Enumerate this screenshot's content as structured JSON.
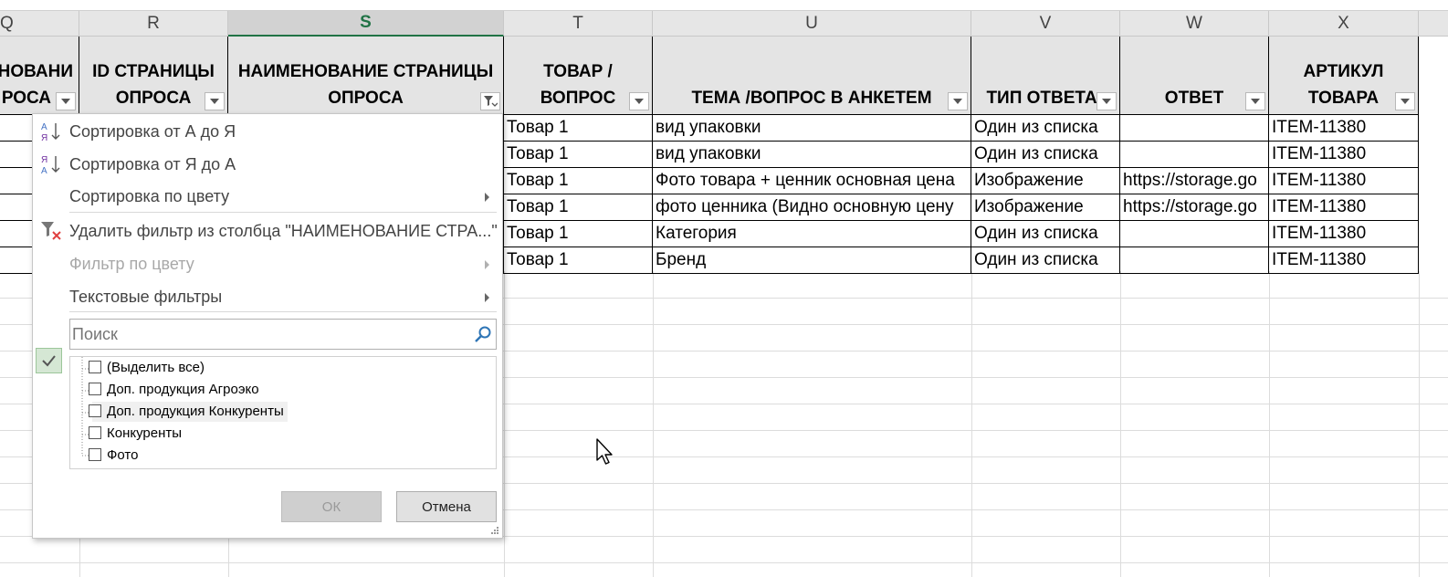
{
  "columns": [
    "Q",
    "R",
    "S",
    "T",
    "U",
    "V",
    "W",
    "X"
  ],
  "headers": {
    "q": [
      "НОВАНИ",
      "РОСА"
    ],
    "r": [
      "ID СТРАНИЦЫ",
      "ОПРОСА"
    ],
    "s": [
      "НАИМЕНОВАНИЕ СТРАНИЦЫ",
      "ОПРОСА"
    ],
    "t": [
      "ТОВАР /",
      "ВОПРОС"
    ],
    "u": "ТЕМА /ВОПРОС В АНКЕТЕМ",
    "v": "ТИП ОТВЕТА",
    "w": "ОТВЕТ",
    "x": [
      "АРТИКУЛ",
      "ТОВАРА"
    ]
  },
  "rows": [
    {
      "t": "Товар 1",
      "u": "вид упаковки",
      "v": "Один из списка",
      "w": "",
      "x": "ITEM-11380"
    },
    {
      "t": "Товар 1",
      "u": "вид упаковки",
      "v": "Один из списка",
      "w": "",
      "x": "ITEM-11380"
    },
    {
      "t": "Товар 1",
      "u": "Фото товара + ценник основная цена",
      "v": "Изображение",
      "w": "https://storage.go",
      "x": "ITEM-11380"
    },
    {
      "t": "Товар 1",
      "u": "фото ценника (Видно основную цену",
      "v": "Изображение",
      "w": "https://storage.go",
      "x": "ITEM-11380"
    },
    {
      "t": "Товар 1",
      "u": "Категория",
      "v": "Один из списка",
      "w": "",
      "x": "ITEM-11380"
    },
    {
      "t": "Товар 1",
      "u": "Бренд",
      "v": "Один из списка",
      "w": "",
      "x": "ITEM-11380"
    }
  ],
  "menu": {
    "sort_az": "Сортировка от А до Я",
    "sort_za": "Сортировка от Я до А",
    "sort_color": "Сортировка по цвету",
    "clear_filter": "Удалить фильтр из столбца \"НАИМЕНОВАНИЕ СТРА...\"",
    "filter_color": "Фильтр по цвету",
    "text_filters": "Текстовые фильтры",
    "search_placeholder": "Поиск",
    "items": [
      "(Выделить все)",
      "Доп. продукция Агроэко",
      "Доп. продукция Конкуренты",
      "Конкуренты",
      "Фото"
    ],
    "ok": "ОК",
    "cancel": "Отмена"
  },
  "icons": {
    "sort_az": "sort-ascending-icon",
    "sort_za": "sort-descending-icon",
    "clear_filter": "clear-filter-icon",
    "search": "magnifier-icon",
    "check": "checkmark-icon",
    "cursor": "mouse-pointer-icon"
  },
  "colors": {
    "accent": "#217346",
    "header_bg": "#e4e4e4",
    "check_bg": "#d5e7d4"
  }
}
